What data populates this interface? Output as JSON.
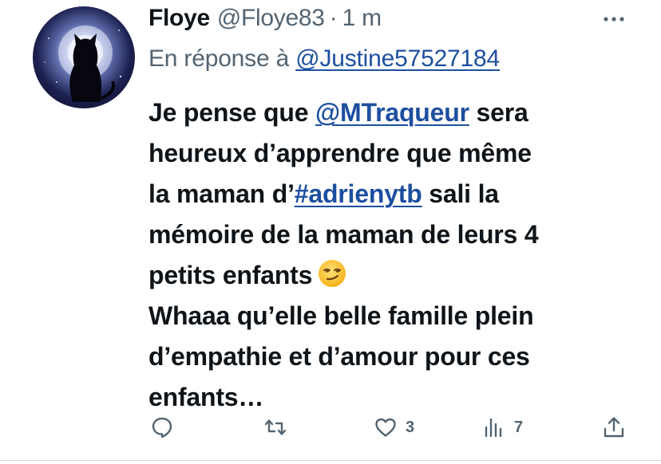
{
  "tweet": {
    "author_name": "Floye",
    "author_handle": "@Floye83",
    "separator": "·",
    "time": "1 m",
    "reply_prefix": "En réponse à",
    "reply_handle": "@Justine57527184",
    "body": {
      "l1_a": "Je pense que ",
      "l1_mention": "@MTraqueur",
      "l1_b": " sera",
      "l2": "heureux d’apprendre que même",
      "l3_a": "la maman d’",
      "l3_hashtag": "#adrienytb",
      "l3_b": " sali la",
      "l4": "mémoire de la maman de leurs 4",
      "l5": "petits enfants",
      "l6": "Whaaa qu’elle belle famille plein",
      "l7": "d’empathie et d’amour pour ces",
      "l8": "enfants…"
    },
    "emoji": "smirking-face",
    "actions": {
      "reply_icon": "reply-icon",
      "retweet_icon": "retweet-icon",
      "like_icon": "heart-icon",
      "like_count": "3",
      "views_icon": "views-icon",
      "views_count": "7",
      "share_icon": "share-icon"
    }
  },
  "colors": {
    "text": "#0f1419",
    "secondary": "#536471",
    "link": "#1d4fa0"
  }
}
